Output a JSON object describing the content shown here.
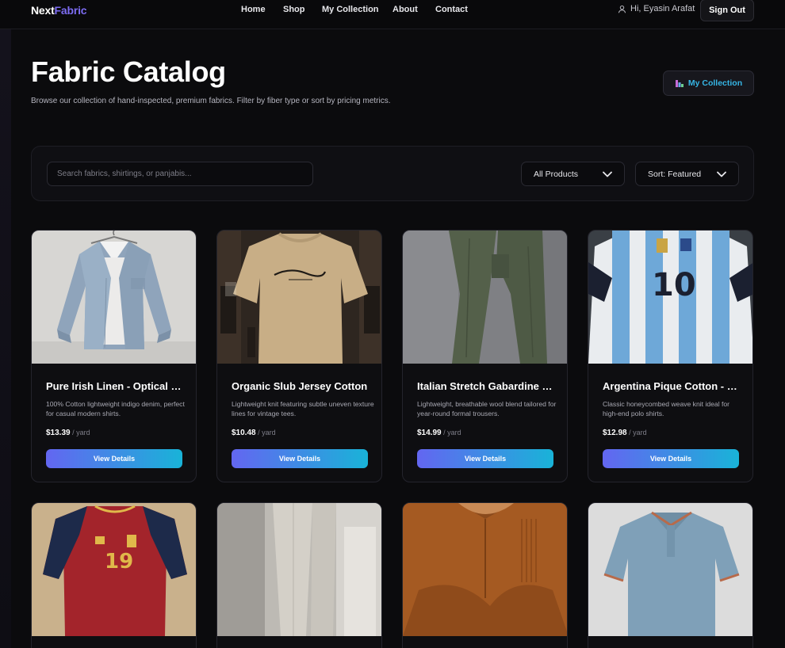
{
  "nav": {
    "logo_part1": "Next",
    "logo_part2": "Fabric",
    "links": [
      {
        "label": "Home"
      },
      {
        "label": "Shop"
      },
      {
        "label": "My Collection"
      },
      {
        "label": "About"
      },
      {
        "label": "Contact"
      }
    ],
    "greeting": "Hi, Eyasin Arafat",
    "user_icon": "user-icon",
    "signout_label": "Sign Out"
  },
  "header": {
    "title": "Fabric Catalog",
    "subtitle": "Browse our collection of hand-inspected, premium fabrics. Filter by fiber type or sort by pricing metrics.",
    "my_collection_label": "My Collection",
    "my_collection_icon": "bar-chart-icon"
  },
  "filters": {
    "search_placeholder": "Search fabrics, shirtings, or panjabis...",
    "category_selected": "All Products",
    "sort_selected": "Sort: Featured"
  },
  "products": [
    {
      "title": "Pure Irish Linen - Optical Blue",
      "desc": "100% Cotton lightweight indigo denim, perfect for casual modern shirts.",
      "price": "$13.39",
      "unit": " / yard",
      "button": "View Details"
    },
    {
      "title": "Organic Slub Jersey Cotton",
      "desc": "Lightweight knit featuring subtle uneven texture lines for vintage tees.",
      "price": "$10.48",
      "unit": " / yard",
      "button": "View Details"
    },
    {
      "title": "Italian Stretch Gabardine Olive",
      "desc": "Lightweight, breathable wool blend tailored for year-round formal trousers.",
      "price": "$14.99",
      "unit": " / yard",
      "button": "View Details"
    },
    {
      "title": "Argentina Pique Cotton - Sky",
      "desc": "Classic honeycombed weave knit ideal for high-end polo shirts.",
      "price": "$12.98",
      "unit": " / yard",
      "button": "View Details"
    }
  ],
  "colors": {
    "accent_start": "#6366f1",
    "accent_end": "#19b3d8",
    "logo_accent": "#7c6cf2",
    "background": "#0b0b0d"
  }
}
